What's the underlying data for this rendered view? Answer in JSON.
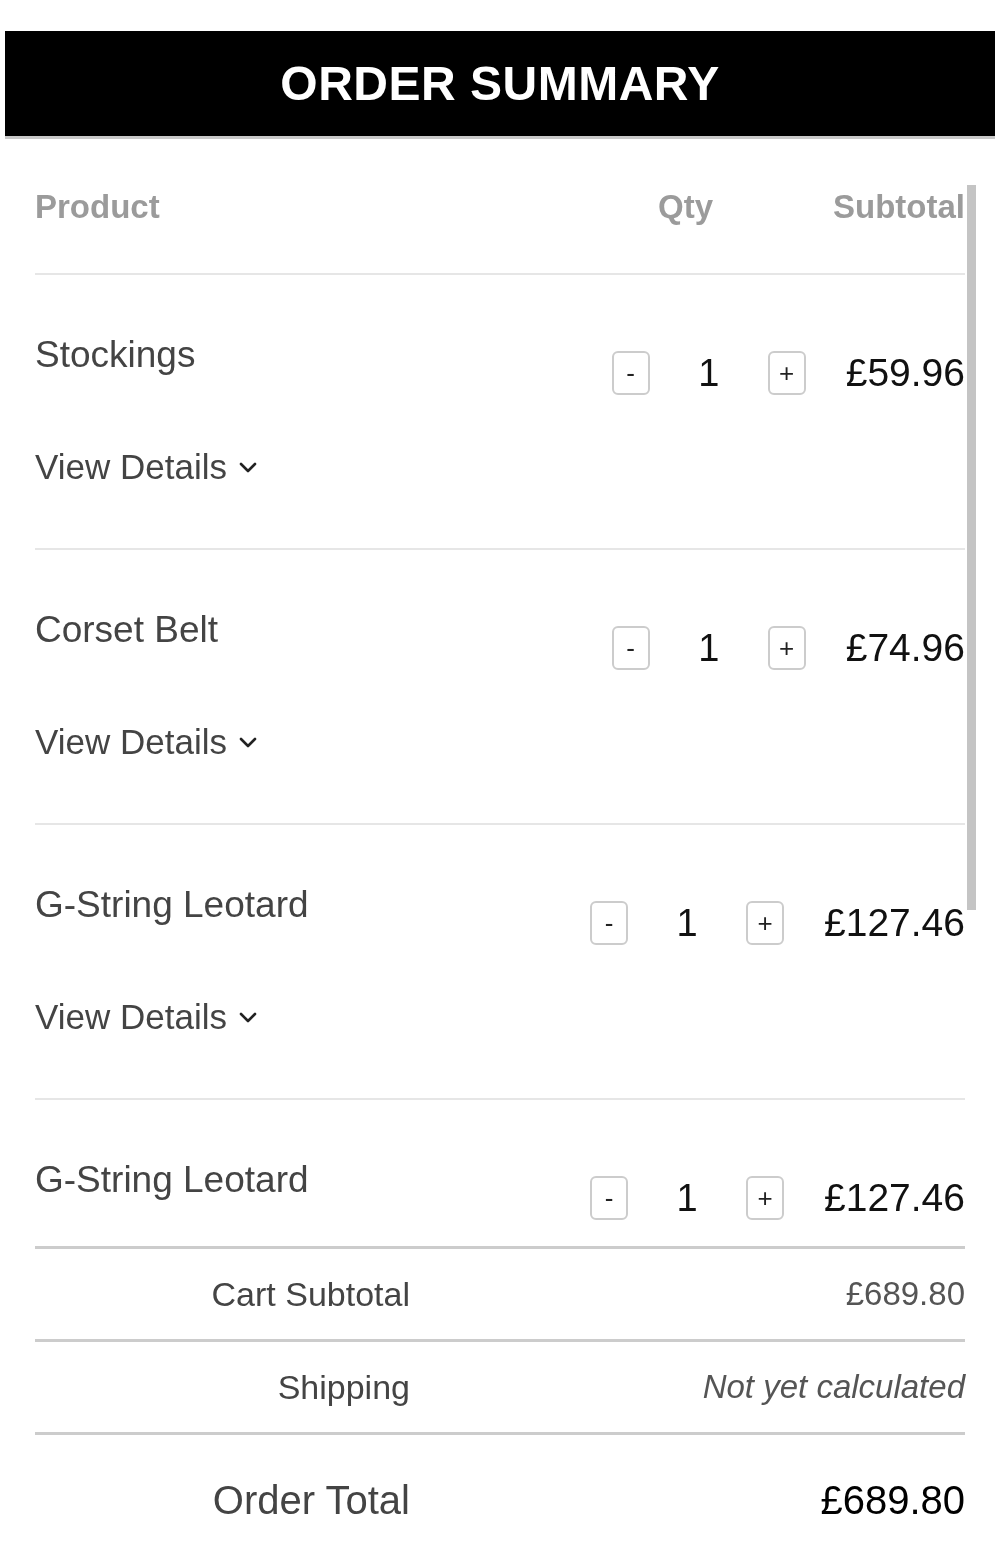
{
  "header": {
    "title": "ORDER SUMMARY"
  },
  "table": {
    "columns": [
      "Product",
      "Qty",
      "Subtotal"
    ],
    "rows": [
      {
        "product": "Stockings",
        "decrease": "-",
        "quantity": "1",
        "increase": "+",
        "subtotal": "£59.96",
        "details": {
          "label": "View Details",
          "expanded": false
        }
      },
      {
        "product": "Corset Belt",
        "decrease": "-",
        "quantity": "1",
        "increase": "+",
        "subtotal": "£74.96",
        "details": {
          "label": "View Details",
          "expanded": false
        }
      },
      {
        "product": "G-String Leotard",
        "decrease": "-",
        "quantity": "1",
        "increase": "+",
        "subtotal": "£127.46",
        "details": {
          "label": "View Details",
          "expanded": false
        }
      },
      {
        "product": "G-String Leotard",
        "decrease": "-",
        "quantity": "1",
        "increase": "+",
        "subtotal": "£127.46"
      }
    ]
  },
  "totals": [
    {
      "kind": "amount",
      "label": "Cart Subtotal",
      "value": "£689.80"
    },
    {
      "kind": "note",
      "label": "Shipping",
      "value": "Not yet calculated"
    },
    {
      "kind": "total",
      "label": "Order Total",
      "value": "£689.80"
    }
  ]
}
